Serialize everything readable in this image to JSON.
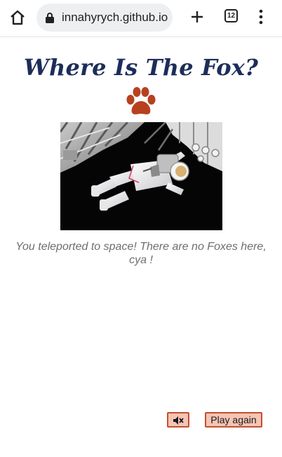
{
  "browser": {
    "url": "innahyrych.github.io",
    "tab_count": "12",
    "icons": {
      "home": "home-icon",
      "lock": "lock-icon",
      "new_tab": "plus-icon",
      "menu": "kebab-menu-icon"
    }
  },
  "page": {
    "title": "Where Is The Fox?",
    "title_icon": "paw-icon",
    "image": "astronaut-in-space",
    "message": "You teleported to space! There are no Foxes here, cya !",
    "colors": {
      "title": "#1d2d5a",
      "paw": "#b7411f",
      "button_fill": "#f6c4b4",
      "button_border": "#c1502e"
    }
  },
  "controls": {
    "mute_icon": "speaker-muted-icon",
    "play_again_label": "Play again"
  }
}
